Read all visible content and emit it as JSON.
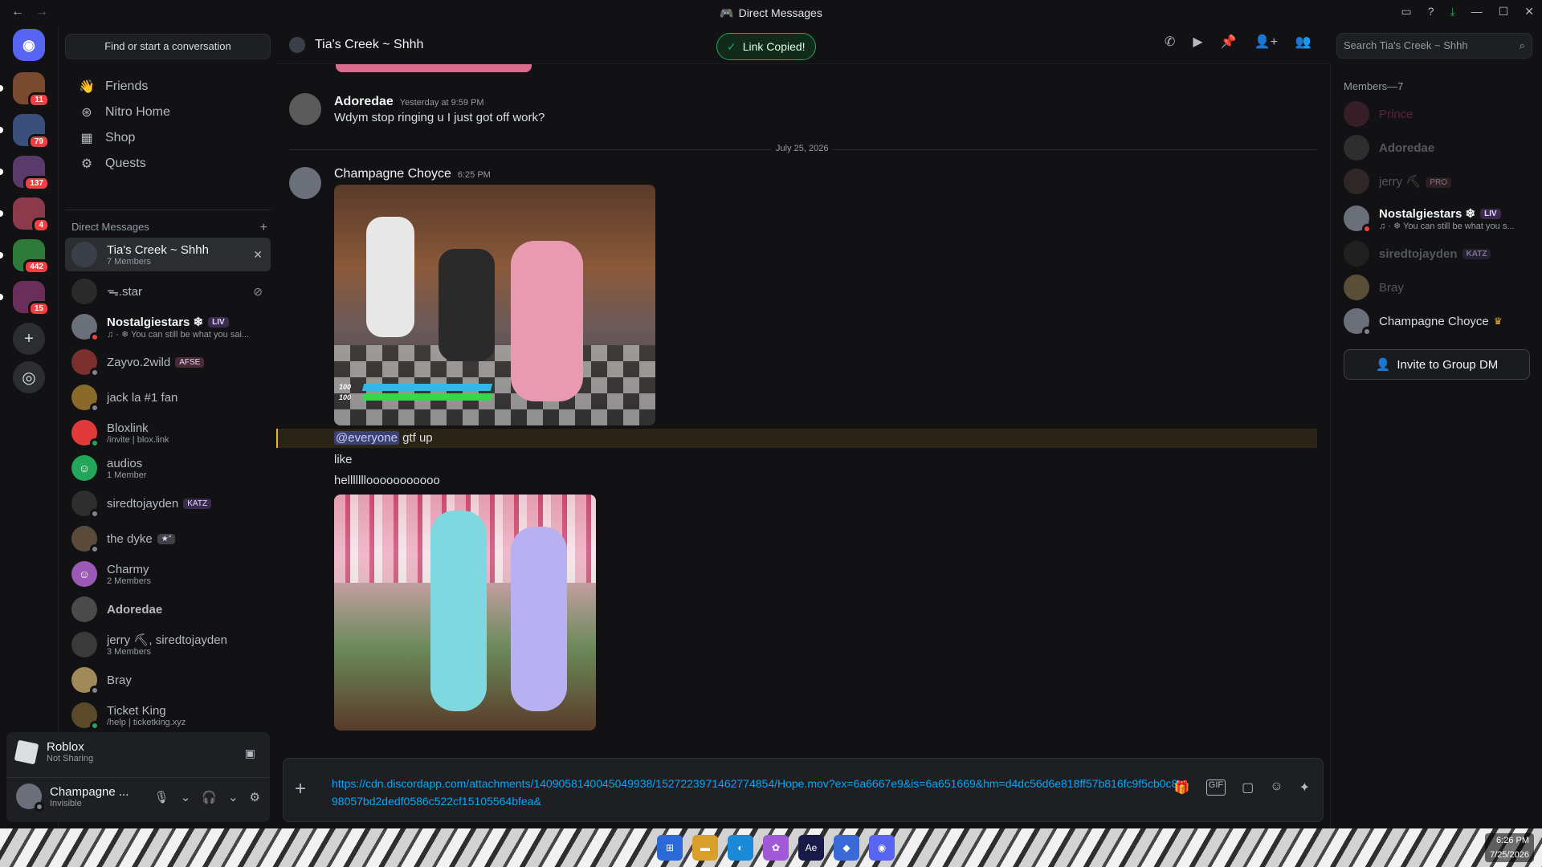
{
  "titlebar": {
    "title": "Direct Messages"
  },
  "server_badges": [
    "11",
    "79",
    "137",
    "4",
    "442",
    "15"
  ],
  "sidebar": {
    "find_placeholder": "Find or start a conversation",
    "nav": [
      "Friends",
      "Nitro Home",
      "Shop",
      "Quests"
    ],
    "dm_header": "Direct Messages",
    "dms": [
      {
        "name": "Tia's Creek ~ Shhh",
        "sub": "7 Members"
      },
      {
        "name": "ᯓ.star",
        "sub": ""
      },
      {
        "name": "Nostalgiestars ❄",
        "tag": "LIV",
        "sub": "♫ · ❄ You can still be what you sai..."
      },
      {
        "name": "Zayvo.2wild",
        "tag": "AFSE",
        "sub": ""
      },
      {
        "name": "jack la #1 fan",
        "sub": ""
      },
      {
        "name": "Bloxlink",
        "sub": "/invite | blox.link"
      },
      {
        "name": "audios",
        "sub": "1 Member"
      },
      {
        "name": "siredtojayden",
        "tag": "KATZ",
        "sub": ""
      },
      {
        "name": "the dyke",
        "tag": "★\"",
        "sub": ""
      },
      {
        "name": "Charmy",
        "sub": "2 Members"
      },
      {
        "name": "Adoredae",
        "sub": ""
      },
      {
        "name": "jerry ⛏, siredtojayden",
        "sub": "3 Members"
      },
      {
        "name": "Bray",
        "sub": ""
      },
      {
        "name": "Ticket King",
        "sub": "/help | ticketking.xyz"
      }
    ]
  },
  "activity": {
    "game": "Roblox",
    "status": "Not Sharing"
  },
  "user": {
    "name": "Champagne ...",
    "status": "Invisible"
  },
  "chat": {
    "channel": "Tia's Creek ~ Shhh",
    "toast": "Link Copied!",
    "search_placeholder": "Search Tia's Creek ~ Shhh",
    "msg1": {
      "author": "Adoredae",
      "time": "Yesterday at 9:59 PM",
      "text": "Wdym stop ringing u I just got off work?"
    },
    "date_divider": "July 25, 2026",
    "msg2": {
      "author": "Champagne Choyce",
      "time": "6:25 PM"
    },
    "hud": {
      "hp1": "100",
      "hp2": "100"
    },
    "lines": {
      "mention": "@everyone",
      "mention_rest": "gtf up",
      "line2": "like",
      "line3": "helllllllooooooooooo"
    },
    "composer_text": "https://cdn.discordapp.com/attachments/1409058140045049938/1527223971462774854/Hope.mov?ex=6a6667e9&is=6a651669&hm=d4dc56d6e818ff57b816fc9f5cb0c898057bd2dedf0586c522cf15105564bfea&"
  },
  "members": {
    "header": "Members—7",
    "list": [
      {
        "name": "Prince",
        "color": "#7a2a4a"
      },
      {
        "name": "Adoredae",
        "color": "#6b6e75"
      },
      {
        "name": "jerry ⛏",
        "tag": "PRO",
        "color": "#6b6e75"
      },
      {
        "name": "Nostalgiestars ❄",
        "tag": "LIV",
        "sub": "♫ · ❄ You can still be what you s...",
        "color": "#f2f3f5"
      },
      {
        "name": "siredtojayden",
        "tag": "KATZ",
        "color": "#6b6e75"
      },
      {
        "name": "Bray",
        "color": "#6b6e75"
      },
      {
        "name": "Champagne Choyce",
        "color": "#dbdee1"
      }
    ],
    "invite": "Invite to Group DM"
  },
  "taskbar": {
    "time": "6:26 PM",
    "date": "7/25/2026"
  },
  "colors": {
    "accent": "#5865f2",
    "online": "#23a55a",
    "dnd": "#f23f43",
    "link": "#00a8fc"
  }
}
